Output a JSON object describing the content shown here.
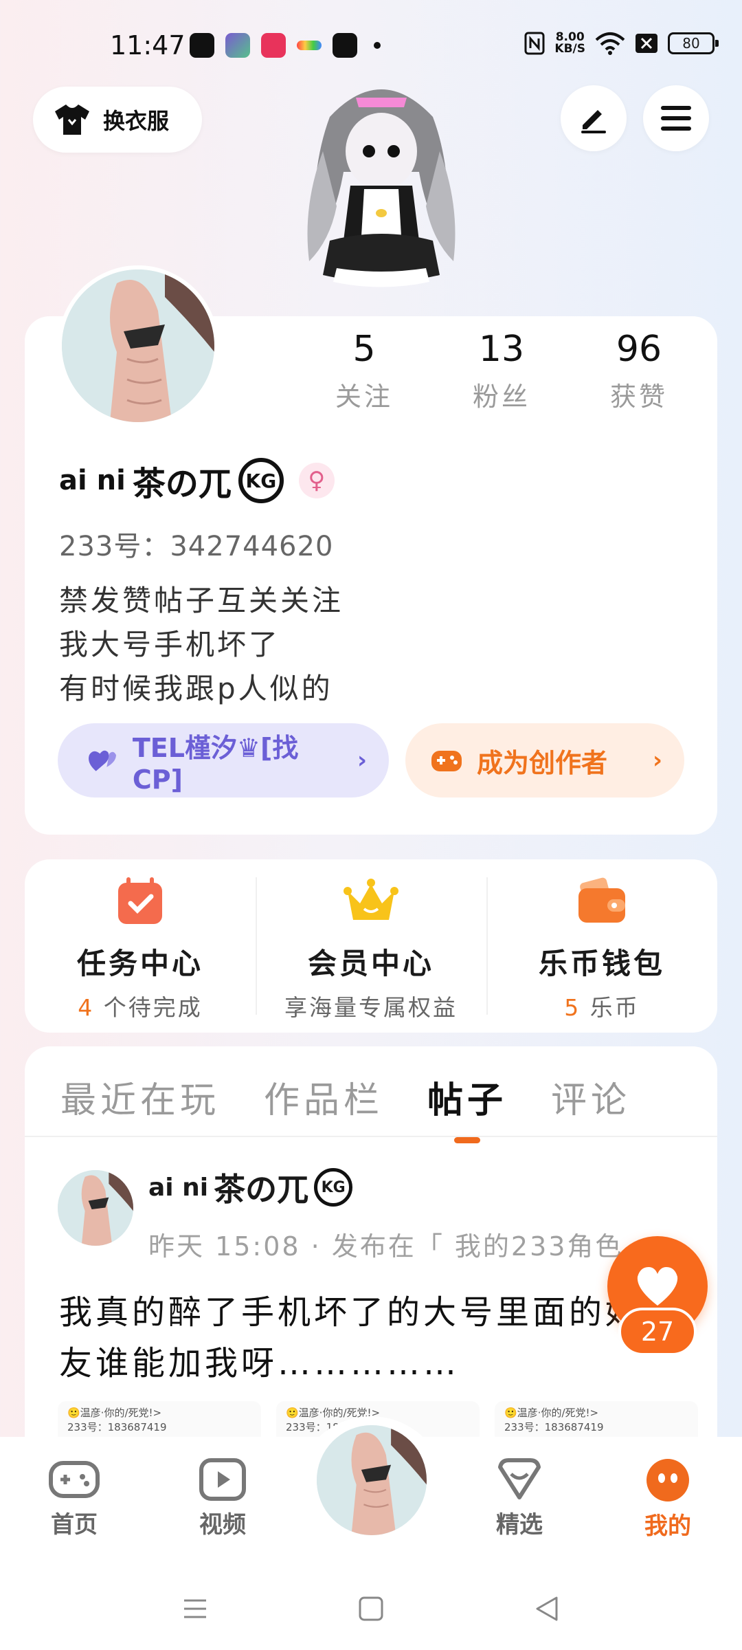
{
  "status_bar": {
    "time": "11:47",
    "net_speed_value": "8.00",
    "net_speed_unit": "KB/S",
    "battery": "80"
  },
  "top": {
    "outfit_label": "换衣服",
    "edit_icon": "pencil-icon",
    "menu_icon": "hamburger-menu-icon"
  },
  "profile": {
    "stats": [
      {
        "value": "5",
        "label": "关注"
      },
      {
        "value": "13",
        "label": "粉丝"
      },
      {
        "value": "96",
        "label": "获赞"
      }
    ],
    "name_prefix": "ai ni",
    "name_main": "茶の兀",
    "name_badge": "KG",
    "gender": "♀",
    "uid": "233号：342744620",
    "bio": [
      "禁发赞帖子互关关注",
      "我大号手机坏了",
      "有时候我跟p人似的"
    ],
    "cp_button": "TEL槿汐♛[找CP]",
    "creator_button": "成为创作者"
  },
  "quick": [
    {
      "title": "任务中心",
      "sub_hl": "4",
      "sub_rest": " 个待完成",
      "icon": "calendar-check-icon"
    },
    {
      "title": "会员中心",
      "sub_hl": "",
      "sub_rest": "享海量专属权益",
      "icon": "crown-icon"
    },
    {
      "title": "乐币钱包",
      "sub_hl": "5",
      "sub_rest": " 乐币",
      "icon": "wallet-icon"
    }
  ],
  "tabs": [
    "最近在玩",
    "作品栏",
    "帖子",
    "评论"
  ],
  "active_tab": "帖子",
  "post": {
    "author_prefix": "ai ni",
    "author_main": "茶の兀",
    "author_badge": "KG",
    "meta": "昨天 15:08 · 发布在「 我的233角色",
    "text": "我真的醉了手机坏了的大号里面的好友谁能加我呀……………",
    "thumbs": [
      {
        "name": "🙂温彦·你的/死党!>",
        "id": "233号：183687419"
      },
      {
        "name": "🙂温彦·你的/死党!>",
        "id": "233号：183687419"
      },
      {
        "name": "🙂温彦·你的/死党!>",
        "id": "233号：183687419"
      }
    ]
  },
  "like_count": "27",
  "nav": {
    "home": "首页",
    "video": "视频",
    "featured": "精选",
    "mine": "我的"
  },
  "colors": {
    "accent": "#f06a1d",
    "cp_purple": "#6b5fd6"
  }
}
